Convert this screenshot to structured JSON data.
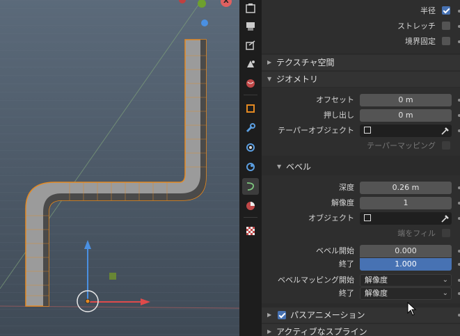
{
  "viewport": {
    "axis_label": "X"
  },
  "toolbar": {
    "icons": [
      "tool-icon",
      "render-icon",
      "output-icon",
      "view-layer-icon",
      "scene-icon",
      "world-icon",
      "object-icon",
      "modifier-icon",
      "particles-icon",
      "physics-icon",
      "curve-data-icon",
      "material-icon",
      "texture-icon"
    ]
  },
  "props": {
    "top": {
      "radius_label": "半径",
      "stretch_label": "ストレッチ",
      "bounds_clamp_label": "境界固定"
    },
    "texture_space": {
      "title": "テクスチャ空間"
    },
    "geometry": {
      "title": "ジオメトリ",
      "offset_label": "オフセット",
      "offset_value": "0 m",
      "extrude_label": "押し出し",
      "extrude_value": "0 m",
      "taper_object_label": "テーパーオブジェクト",
      "taper_mapping_label": "テーパーマッピング"
    },
    "bevel": {
      "title": "ベベル",
      "depth_label": "深度",
      "depth_value": "0.26 m",
      "resolution_label": "解像度",
      "resolution_value": "1",
      "object_label": "オブジェクト",
      "fill_caps_label": "端をフィル",
      "bevel_start_label": "ベベル開始",
      "bevel_start_value": "0.000",
      "end_label": "終了",
      "end_value": "1.000",
      "mapping_start_label": "ベベルマッピング開始",
      "mapping_start_value": "解像度",
      "mapping_end_label": "終了",
      "mapping_end_value": "解像度"
    },
    "path_animation": {
      "title": "パスアニメーション"
    },
    "active_spline": {
      "title": "アクティブなスプライン"
    }
  }
}
